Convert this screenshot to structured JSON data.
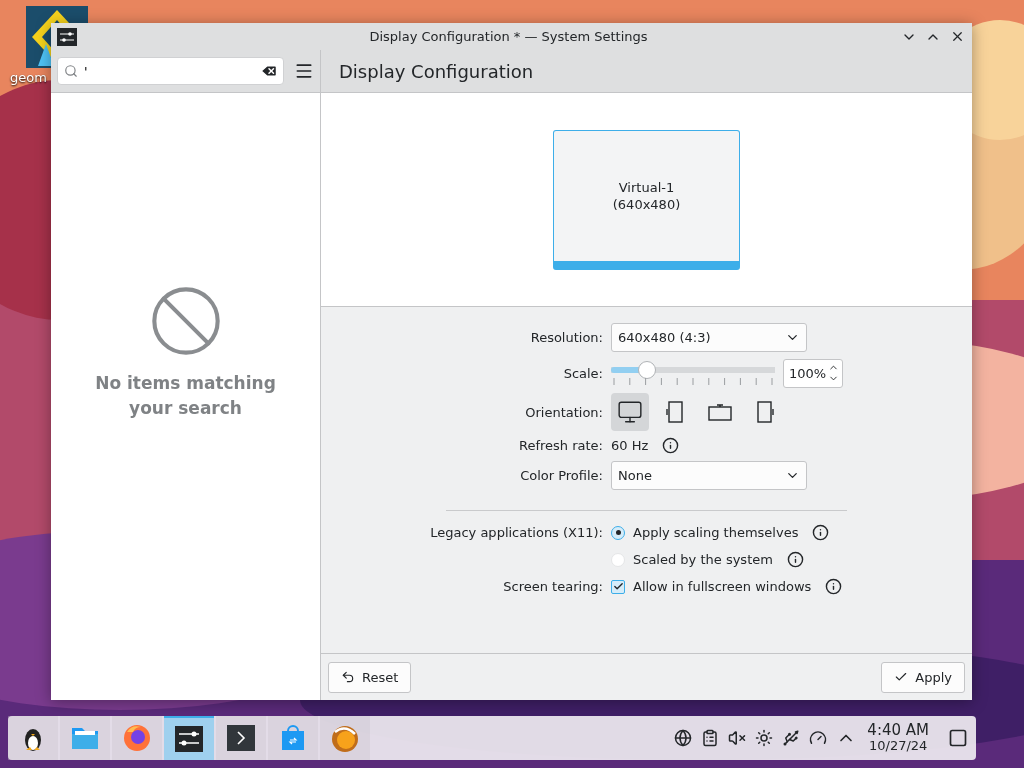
{
  "desktop": {
    "icons": [
      {
        "label": "geom"
      }
    ]
  },
  "window": {
    "title": "Display Configuration * — System Settings"
  },
  "search": {
    "value": "'"
  },
  "page_title": "Display Configuration",
  "sidebar": {
    "empty_message": "No items matching your search"
  },
  "outputs": [
    {
      "name": "Virtual-1",
      "mode": "(640x480)",
      "selected": true
    }
  ],
  "settings": {
    "resolution": {
      "label": "Resolution:",
      "value": "640x480 (4:3)"
    },
    "scale": {
      "label": "Scale:",
      "level": 0.22,
      "value": "100%"
    },
    "orientation": {
      "label": "Orientation:",
      "options": [
        {
          "kind": "landscape",
          "selected": true
        },
        {
          "kind": "portrait",
          "selected": false
        },
        {
          "kind": "inverted",
          "selected": false
        },
        {
          "kind": "portrait-right",
          "selected": false
        }
      ]
    },
    "refresh_rate": {
      "label": "Refresh rate:",
      "value": "60 Hz"
    },
    "color_profile": {
      "label": "Color Profile:",
      "value": "None"
    },
    "legacy": {
      "label": "Legacy applications (X11):",
      "options": [
        {
          "label": "Apply scaling themselves",
          "selected": true
        },
        {
          "label": "Scaled by the system",
          "selected": false
        }
      ]
    },
    "tearing": {
      "label": "Screen tearing:",
      "option": {
        "label": "Allow in fullscreen windows",
        "checked": true
      }
    }
  },
  "buttons": [
    {
      "kind": "reset",
      "label": "Reset"
    },
    {
      "kind": "apply",
      "label": "Apply"
    }
  ],
  "taskbar": {
    "apps": [
      {
        "kind": "penguin",
        "selected": false
      },
      {
        "kind": "folder",
        "selected": false
      },
      {
        "kind": "browser",
        "selected": false
      },
      {
        "kind": "settings",
        "selected": true
      },
      {
        "kind": "terminal",
        "selected": false
      },
      {
        "kind": "store",
        "selected": false
      },
      {
        "kind": "swirl",
        "selected": false
      }
    ],
    "clock": {
      "time": "4:40 AM",
      "date": "10/27/24"
    }
  }
}
